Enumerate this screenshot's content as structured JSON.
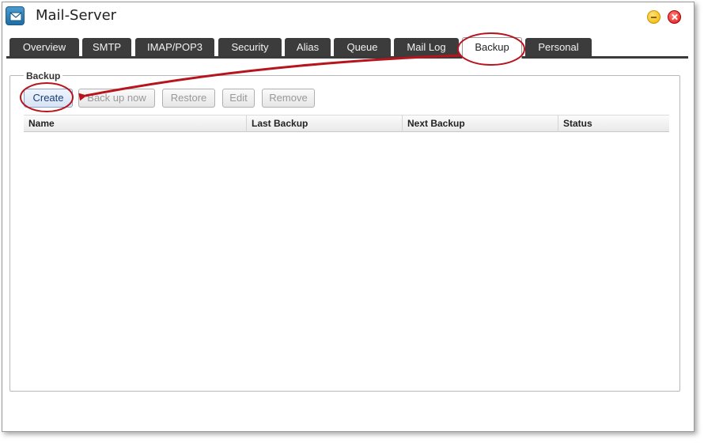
{
  "window": {
    "title": "Mail-Server"
  },
  "tabs": [
    {
      "label": "Overview"
    },
    {
      "label": "SMTP"
    },
    {
      "label": "IMAP/POP3"
    },
    {
      "label": "Security"
    },
    {
      "label": "Alias"
    },
    {
      "label": "Queue"
    },
    {
      "label": "Mail Log"
    },
    {
      "label": "Backup"
    },
    {
      "label": "Personal"
    }
  ],
  "active_tab": "Backup",
  "backup": {
    "legend": "Backup",
    "toolbar": {
      "create_label": "Create",
      "backup_now_label": "Back up now",
      "restore_label": "Restore",
      "edit_label": "Edit",
      "remove_label": "Remove"
    },
    "columns": [
      "Name",
      "Last Backup",
      "Next Backup",
      "Status"
    ],
    "rows": []
  },
  "colors": {
    "tab_background": "#3c3c3c",
    "annotation_red": "#b8141e",
    "primary_button_text": "#1c3b78"
  },
  "icons": {
    "app": "mail-server-icon",
    "minimize": "minimize-icon",
    "close": "close-icon",
    "annotation": "annotation-arrow-icon"
  }
}
